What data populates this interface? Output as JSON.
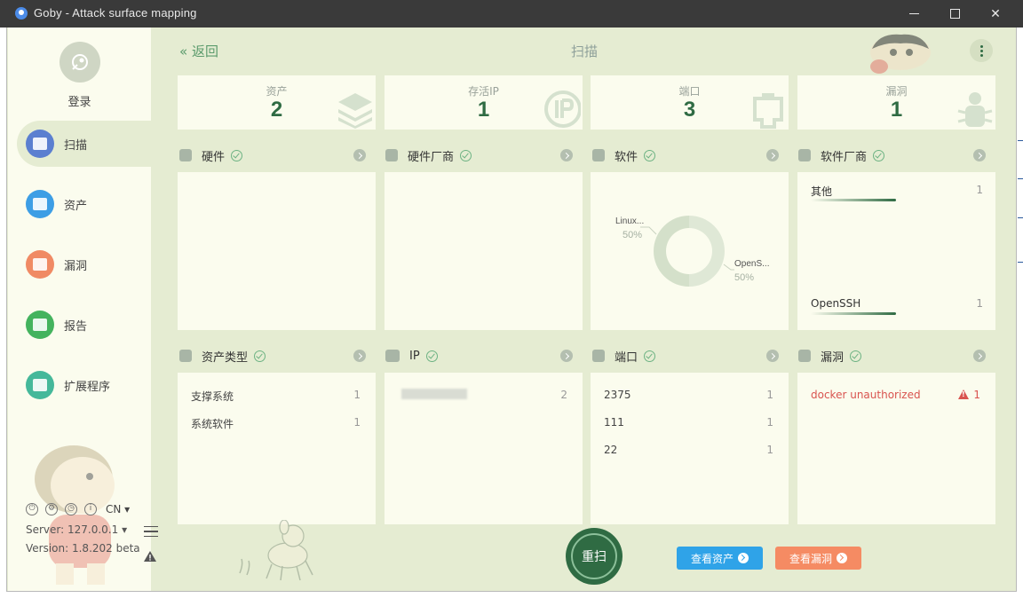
{
  "window": {
    "title": "Goby - Attack surface mapping"
  },
  "sidebar": {
    "login_label": "登录",
    "items": [
      {
        "label": "扫描",
        "icon": "scan-icon",
        "color": "#5b7fd0",
        "active": true
      },
      {
        "label": "资产",
        "icon": "assets-icon",
        "color": "#3d9ee5",
        "active": false
      },
      {
        "label": "漏洞",
        "icon": "vulnerability-icon",
        "color": "#f08a64",
        "active": false
      },
      {
        "label": "报告",
        "icon": "report-icon",
        "color": "#44b35e",
        "active": false
      },
      {
        "label": "扩展程序",
        "icon": "extension-icon",
        "color": "#45b89a",
        "active": false
      }
    ],
    "language": "CN",
    "server": "Server: 127.0.0.1",
    "version": "Version: 1.8.202 beta"
  },
  "header": {
    "back_label": "返回",
    "title": "扫描"
  },
  "stats": [
    {
      "label": "资产",
      "value": "2",
      "icon": "layers-icon"
    },
    {
      "label": "存活IP",
      "value": "1",
      "icon": "ip-icon"
    },
    {
      "label": "端口",
      "value": "3",
      "icon": "port-icon"
    },
    {
      "label": "漏洞",
      "value": "1",
      "icon": "bug-icon"
    }
  ],
  "sections": {
    "hardware": {
      "title": "硬件"
    },
    "hardware_vendor": {
      "title": "硬件厂商"
    },
    "software": {
      "title": "软件",
      "chart_data": {
        "type": "pie",
        "categories": [
          "Linux...",
          "OpenS..."
        ],
        "values": [
          50,
          50
        ],
        "labels": [
          "50%",
          "50%"
        ]
      }
    },
    "software_vendor": {
      "title": "软件厂商",
      "items": [
        {
          "name": "其他",
          "count": "1",
          "share": 1.0
        },
        {
          "name": "OpenSSH",
          "count": "1",
          "share": 1.0
        }
      ]
    },
    "asset_type": {
      "title": "资产类型",
      "items": [
        {
          "name": "支撑系统",
          "count": "1"
        },
        {
          "name": "系统软件",
          "count": "1"
        }
      ]
    },
    "ip": {
      "title": "IP",
      "items": [
        {
          "count": "2"
        }
      ]
    },
    "port": {
      "title": "端口",
      "items": [
        {
          "name": "2375",
          "count": "1"
        },
        {
          "name": "111",
          "count": "1"
        },
        {
          "name": "22",
          "count": "1"
        }
      ]
    },
    "vuln": {
      "title": "漏洞",
      "items": [
        {
          "name": "docker unauthorized",
          "count": "1"
        }
      ]
    }
  },
  "footer": {
    "rescan_label": "重扫",
    "view_assets_label": "查看资产",
    "view_vulns_label": "查看漏洞"
  },
  "colors": {
    "accent": "#2f6b43",
    "bg": "#e5ecd2",
    "panel": "#fbfcee",
    "danger": "#d9534f",
    "assets_button": "#2fa3e8",
    "vulns_button": "#f58b63"
  }
}
